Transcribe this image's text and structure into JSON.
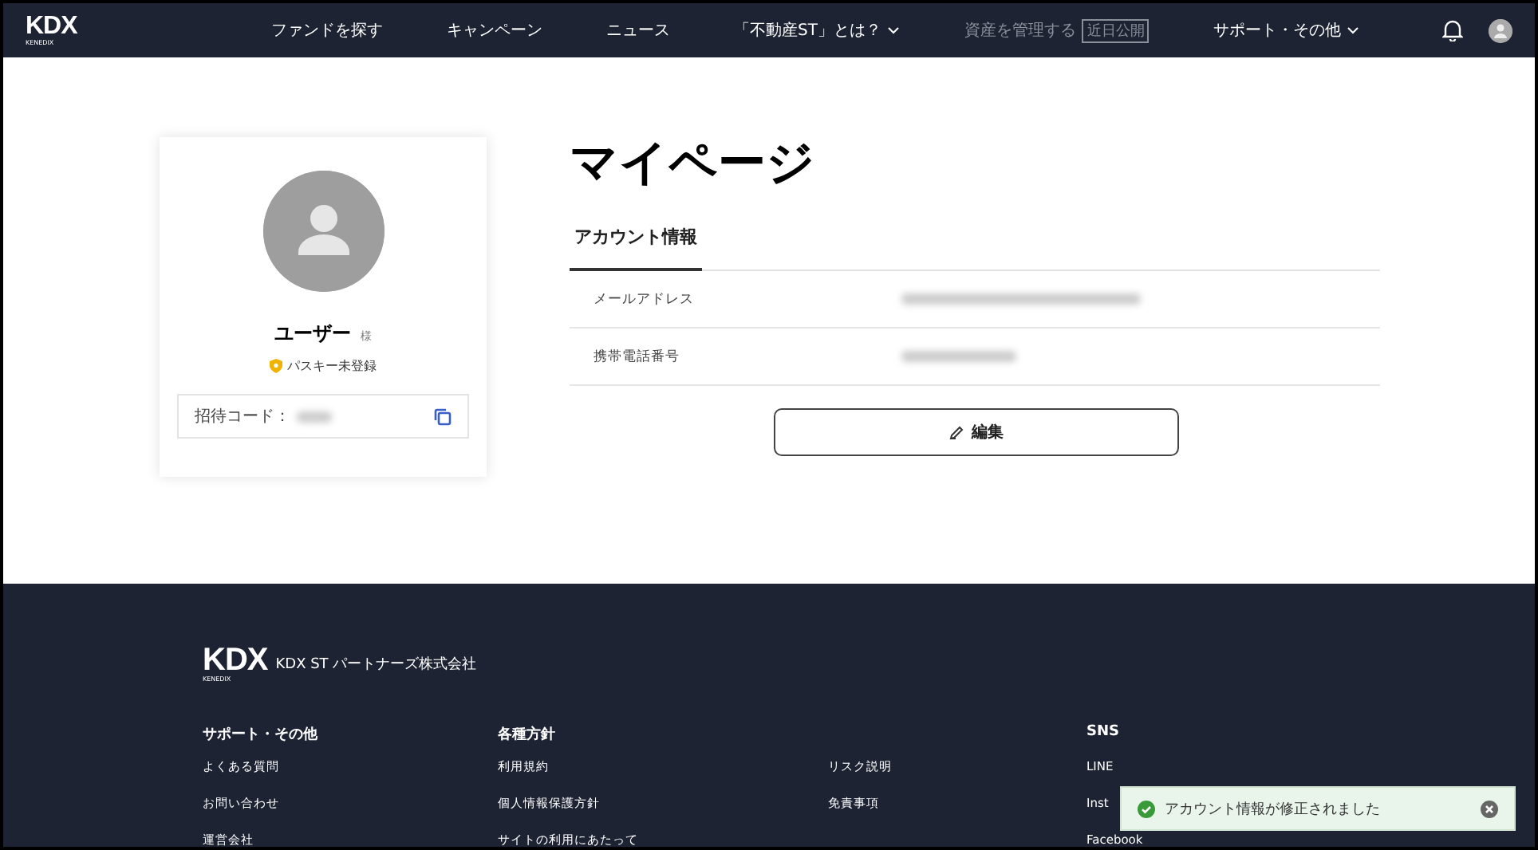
{
  "header": {
    "logo": "KDX",
    "logo_sub": "KENEDIX",
    "nav": [
      {
        "label": "ファンドを探す",
        "dropdown": false,
        "disabled": false
      },
      {
        "label": "キャンペーン",
        "dropdown": false,
        "disabled": false
      },
      {
        "label": "ニュース",
        "dropdown": false,
        "disabled": false
      },
      {
        "label": "「不動産ST」とは？",
        "dropdown": true,
        "disabled": false
      },
      {
        "label": "資産を管理する",
        "badge": "近日公開",
        "dropdown": false,
        "disabled": true
      },
      {
        "label": "サポート・その他",
        "dropdown": true,
        "disabled": false
      }
    ]
  },
  "profile": {
    "name": "ユーザー",
    "honorific": "様",
    "passkey": "パスキー未登録",
    "invite_label": "招待コード："
  },
  "main": {
    "title": "マイページ",
    "tabs": [
      {
        "label": "アカウント情報",
        "selected": true
      }
    ],
    "fields": [
      {
        "label": "メールアドレス"
      },
      {
        "label": "携帯電話番号"
      }
    ],
    "edit_button": "編集"
  },
  "footer": {
    "logo": "KDX",
    "logo_sub": "KENEDIX",
    "company": "KDX ST パートナーズ株式会社",
    "columns": [
      {
        "heading": "サポート・その他",
        "links": [
          "よくある質問",
          "お問い合わせ",
          "運営会社"
        ]
      },
      {
        "heading": "各種方針",
        "links": [
          "利用規約",
          "個人情報保護方針",
          "サイトの利用にあたって"
        ]
      },
      {
        "links": [
          "リスク説明",
          "免責事項"
        ]
      },
      {
        "heading": "SNS",
        "links": [
          "LINE",
          "Inst",
          "Facebook"
        ]
      }
    ]
  },
  "toast": {
    "message": "アカウント情報が修正されました"
  }
}
